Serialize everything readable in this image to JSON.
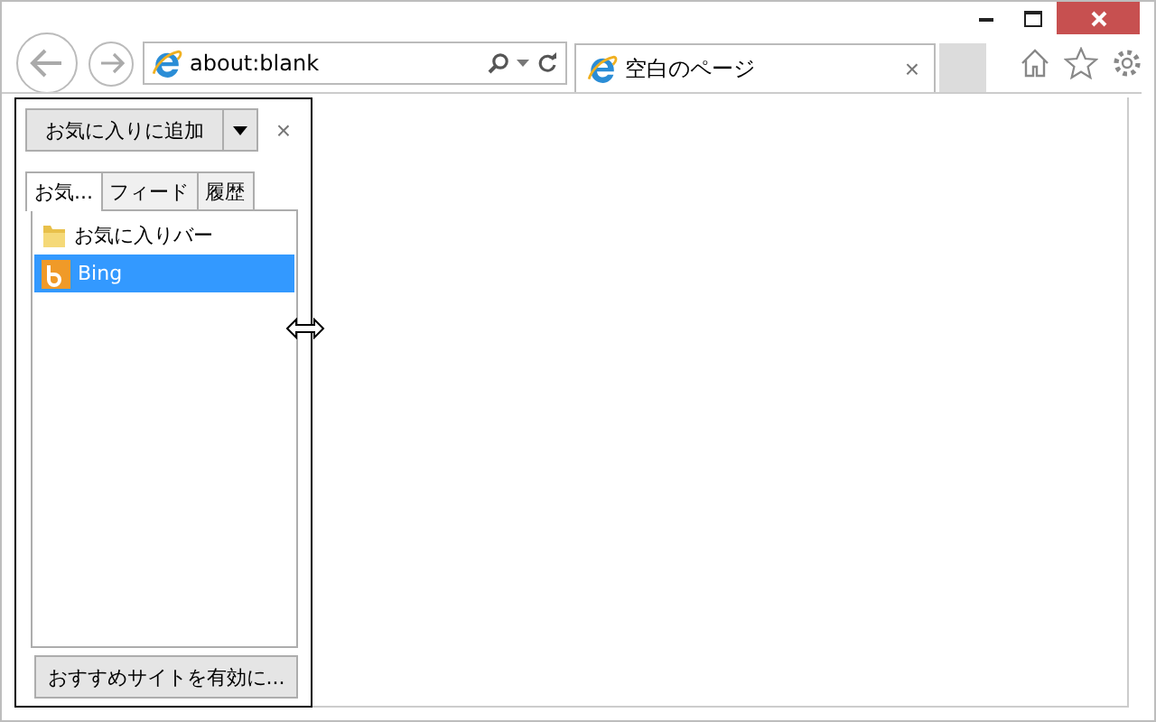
{
  "address_bar": {
    "value": "about:blank"
  },
  "tab": {
    "title": "空白のページ",
    "close": "×"
  },
  "favorites_panel": {
    "add_button": "お気に入りに追加",
    "close": "×",
    "tabs": [
      {
        "label": "お気...",
        "selected": true
      },
      {
        "label": "フィード",
        "selected": false
      },
      {
        "label": "履歴",
        "selected": false
      }
    ],
    "items": [
      {
        "label": "お気に入りバー",
        "kind": "folder",
        "selected": false
      },
      {
        "label": "Bing",
        "kind": "site",
        "selected": true
      }
    ],
    "footer_button": "おすすめサイトを有効に..."
  }
}
